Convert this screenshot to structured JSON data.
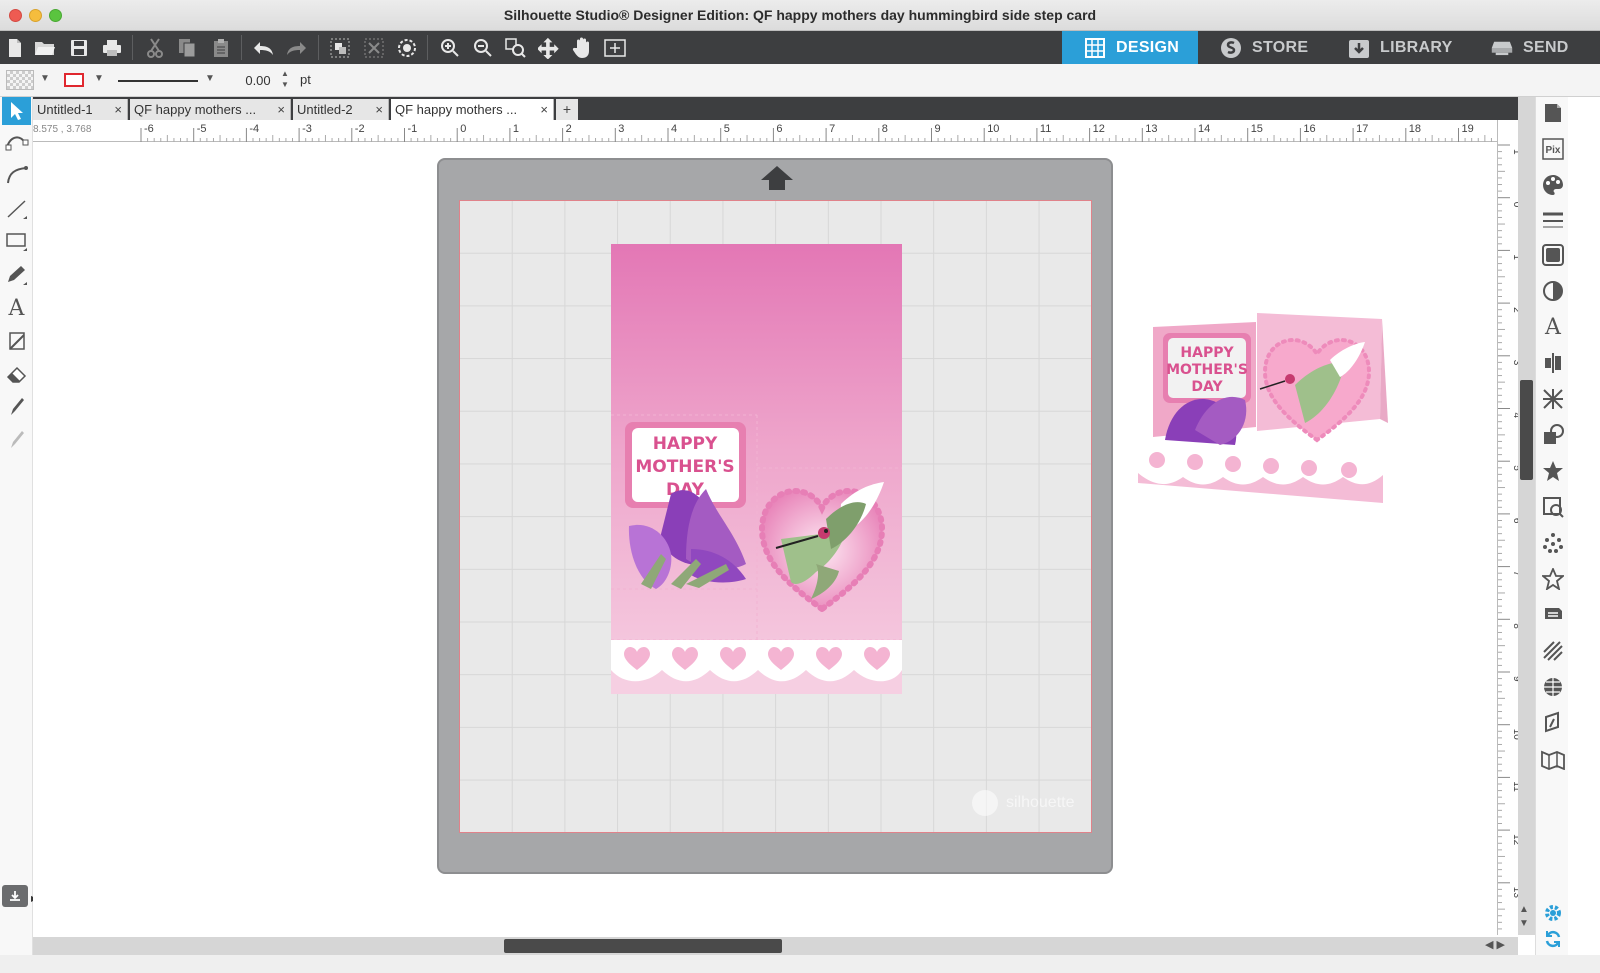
{
  "window": {
    "title": "Silhouette Studio® Designer Edition: QF happy mothers day hummingbird side step card"
  },
  "toolbar": {
    "icons": [
      "new-file-icon",
      "open-folder-icon",
      "save-icon",
      "print-icon",
      "cut-icon",
      "copy-icon",
      "paste-icon",
      "undo-icon",
      "redo-icon",
      "group-icon",
      "ungroup-icon",
      "release-compound-icon",
      "zoom-in-icon",
      "zoom-out-icon",
      "zoom-fit-icon",
      "move-down-icon",
      "pan-hand-icon",
      "add-page-icon"
    ]
  },
  "nav_tabs": [
    {
      "label": "DESIGN",
      "icon": "design-grid-icon",
      "active": true
    },
    {
      "label": "STORE",
      "icon": "store-s-icon",
      "active": false
    },
    {
      "label": "LIBRARY",
      "icon": "library-download-icon",
      "active": false
    },
    {
      "label": "SEND",
      "icon": "send-cutter-icon",
      "active": false
    }
  ],
  "properties": {
    "line_width": "0.00",
    "unit": "pt",
    "line_color": "#e0282f"
  },
  "doc_tabs": [
    {
      "label": "Untitled-1",
      "active": false
    },
    {
      "label": "QF happy mothers ...",
      "active": false
    },
    {
      "label": "Untitled-2",
      "active": false
    },
    {
      "label": "QF happy mothers ...",
      "active": true
    }
  ],
  "ruler": {
    "coord_readout": "8.575 , 3.768",
    "h_labels": [
      "-6",
      "-5",
      "-4",
      "-3",
      "-2",
      "-1",
      "0",
      "1",
      "2",
      "3",
      "4",
      "5",
      "6",
      "7",
      "8",
      "9",
      "10",
      "11",
      "12",
      "13",
      "14",
      "15",
      "16",
      "17",
      "18",
      "19"
    ],
    "v_labels": [
      "1",
      "0",
      "1",
      "2",
      "3",
      "4",
      "5",
      "6",
      "7",
      "8",
      "9",
      "10",
      "11",
      "12",
      "13"
    ]
  },
  "card": {
    "message_lines": [
      "HAPPY",
      "MOTHER'S",
      "DAY"
    ]
  },
  "watermark": "silhouette",
  "colors": {
    "accent": "#2b9fd8",
    "toolbar_bg": "#3d3e40",
    "pink_dark": "#e377b5",
    "pink_light": "#f4c6dd",
    "text_pink": "#d9518f",
    "leaf_green": "#8fa878",
    "flower_purple": "#a45bc2"
  }
}
